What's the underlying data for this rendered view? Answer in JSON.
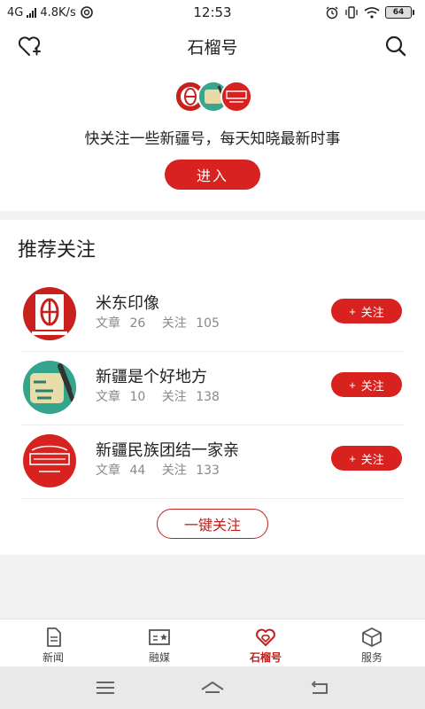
{
  "status_bar": {
    "network": "4G",
    "speed": "4.8K/s",
    "time": "12:53",
    "battery": "64"
  },
  "header": {
    "title": "石榴号",
    "left_icon": "heart-plus-icon",
    "right_icon": "search-icon"
  },
  "intro": {
    "text": "快关注一些新疆号，每天知晓最新时事",
    "enter_label": "进入"
  },
  "recommend": {
    "title": "推荐关注",
    "articles_label": "文章",
    "follows_label": "关注",
    "follow_button_label": "关注",
    "follow_button_prefix": "+",
    "items": [
      {
        "name": "米东印像",
        "articles": "26",
        "follows": "105"
      },
      {
        "name": "新疆是个好地方",
        "articles": "10",
        "follows": "138"
      },
      {
        "name": "新疆民族团结一家亲",
        "articles": "44",
        "follows": "133"
      }
    ],
    "onekey_label": "一键关注"
  },
  "tabbar": {
    "tabs": [
      {
        "label": "新闻",
        "icon": "document-icon",
        "active": false
      },
      {
        "label": "融媒",
        "icon": "media-card-icon",
        "active": false
      },
      {
        "label": "石榴号",
        "icon": "hearts-icon",
        "active": true
      },
      {
        "label": "服务",
        "icon": "box-icon",
        "active": false
      }
    ]
  },
  "colors": {
    "accent": "#d8221f",
    "text": "#222222",
    "muted": "#888888",
    "background": "#f2f2f2"
  }
}
